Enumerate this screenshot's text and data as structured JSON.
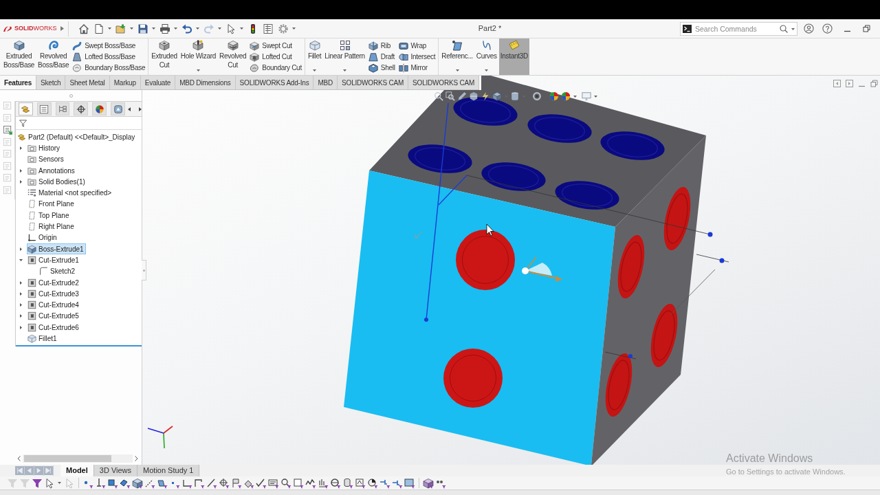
{
  "title_bar": {
    "logo": "**SOLID**WORKS",
    "document_title": "Part2 *",
    "search": {
      "placeholder": "Search Commands"
    }
  },
  "quick_access": [
    {
      "kind": "home",
      "disabled": false
    },
    {
      "kind": "new",
      "dropdown": true,
      "disabled": false
    },
    {
      "kind": "open",
      "dropdown": true,
      "disabled": false
    },
    {
      "kind": "save",
      "dropdown": true,
      "disabled": false
    },
    {
      "kind": "print",
      "dropdown": true,
      "disabled": false
    },
    {
      "kind": "undo",
      "dropdown": true,
      "disabled": false
    },
    {
      "kind": "redo",
      "dropdown": true,
      "disabled": true
    },
    {
      "kind": "select",
      "dropdown": true,
      "disabled": false
    },
    {
      "kind": "rebuild",
      "disabled": false
    },
    {
      "kind": "properties",
      "disabled": false
    },
    {
      "kind": "options",
      "dropdown": true,
      "disabled": false
    }
  ],
  "ribbon": [
    {
      "items": [
        {
          "kind": "large",
          "label": "Extruded\nBoss/Base",
          "pressed": false
        },
        {
          "kind": "large",
          "label": "Revolved\nBoss/Base",
          "pressed": false
        },
        {
          "kind": "stack",
          "labels": [
            "Swept Boss/Base",
            "Lofted Boss/Base",
            "Boundary Boss/Base"
          ]
        }
      ]
    },
    {
      "items": [
        {
          "kind": "large",
          "label": "Extruded\nCut",
          "pressed": false
        },
        {
          "kind": "large",
          "label": "Hole Wizard",
          "dropdown": true,
          "pressed": false
        },
        {
          "kind": "large",
          "label": "Revolved\nCut",
          "pressed": false
        },
        {
          "kind": "stack",
          "labels": [
            "Swept Cut",
            "Lofted Cut",
            "Boundary Cut"
          ]
        }
      ]
    },
    {
      "items": [
        {
          "kind": "large",
          "label": "Fillet",
          "dropdown": true,
          "pressed": false
        },
        {
          "kind": "large",
          "label": "Linear Pattern",
          "dropdown": true,
          "pressed": false
        },
        {
          "kind": "stack",
          "labels": [
            "Rib",
            "Draft",
            "Shell"
          ]
        },
        {
          "kind": "stack",
          "labels": [
            "Wrap",
            "Intersect",
            "Mirror"
          ]
        }
      ]
    },
    {
      "items": [
        {
          "kind": "large",
          "label": "Referenc...",
          "dropdown": true,
          "pressed": false
        },
        {
          "kind": "large",
          "label": "Curves",
          "dropdown": true,
          "pressed": false
        },
        {
          "kind": "large",
          "label": "Instant3D",
          "pressed": true
        }
      ]
    }
  ],
  "tabs": [
    {
      "label": "Features",
      "selected": true
    },
    {
      "label": "Sketch",
      "selected": false
    },
    {
      "label": "Sheet Metal",
      "selected": false
    },
    {
      "label": "Markup",
      "selected": false
    },
    {
      "label": "Evaluate",
      "selected": false
    },
    {
      "label": "MBD Dimensions",
      "selected": false
    },
    {
      "label": "SOLIDWORKS Add-Ins",
      "selected": false
    },
    {
      "label": "MBD",
      "selected": false
    },
    {
      "label": "SOLIDWORKS CAM",
      "selected": false
    },
    {
      "label": "SOLIDWORKS CAM",
      "selected": false
    }
  ],
  "side_tools": [
    {
      "disabled": true
    },
    {
      "disabled": true
    },
    {
      "disabled": false
    },
    {
      "disabled": true
    },
    {
      "disabled": true
    },
    {
      "disabled": true
    },
    {
      "disabled": true
    },
    {
      "disabled": true
    }
  ],
  "panel_tabs": [
    {
      "selected": true
    },
    {
      "selected": false
    },
    {
      "selected": false
    },
    {
      "selected": false
    },
    {
      "selected": false
    },
    {
      "selected": false
    }
  ],
  "tree": {
    "label": "Part2 (Default) <<Default>_Display",
    "selected": false,
    "children": [
      {
        "label": "History",
        "kind": "folder",
        "expanded": false,
        "selected": false
      },
      {
        "label": "Sensors",
        "kind": "folder",
        "selected": false
      },
      {
        "label": "Annotations",
        "kind": "folder",
        "expanded": false,
        "selected": false
      },
      {
        "label": "Solid Bodies(1)",
        "kind": "folder",
        "expanded": false,
        "selected": false
      },
      {
        "label": "Material <not specified>",
        "kind": "material",
        "selected": false
      },
      {
        "label": "Front Plane",
        "kind": "plane",
        "selected": false
      },
      {
        "label": "Top Plane",
        "kind": "plane",
        "selected": false
      },
      {
        "label": "Right Plane",
        "kind": "plane",
        "selected": false
      },
      {
        "label": "Origin",
        "kind": "origin",
        "selected": false
      },
      {
        "label": "Boss-Extrude1",
        "kind": "boss",
        "expanded": false,
        "selected": true
      },
      {
        "label": "Cut-Extrude1",
        "kind": "cut",
        "expanded": true,
        "selected": false,
        "children": [
          {
            "label": "Sketch2",
            "kind": "sketch",
            "selected": false
          }
        ]
      },
      {
        "label": "Cut-Extrude2",
        "kind": "cut",
        "expanded": false,
        "selected": false
      },
      {
        "label": "Cut-Extrude3",
        "kind": "cut",
        "expanded": false,
        "selected": false
      },
      {
        "label": "Cut-Extrude4",
        "kind": "cut",
        "expanded": false,
        "selected": false
      },
      {
        "label": "Cut-Extrude5",
        "kind": "cut",
        "expanded": false,
        "selected": false
      },
      {
        "label": "Cut-Extrude6",
        "kind": "cut",
        "expanded": false,
        "selected": false
      },
      {
        "label": "Fillet1",
        "kind": "fillet",
        "selected": false
      }
    ]
  },
  "bottom_tabs": [
    {
      "label": "Model",
      "selected": true
    },
    {
      "label": "3D Views",
      "selected": false
    },
    {
      "label": "Motion Study 1",
      "selected": false
    }
  ],
  "filter_toolbar": [
    {
      "disabled": true
    },
    {
      "disabled": true
    },
    {
      "disabled": false
    },
    {
      "disabled": false
    },
    {
      "disabled": true
    },
    {
      "disabled": false
    },
    {
      "disabled": false
    },
    {
      "disabled": false
    },
    {
      "disabled": false
    },
    {
      "disabled": false
    },
    {
      "disabled": false
    },
    {
      "disabled": false
    },
    {
      "disabled": false
    },
    {
      "disabled": false
    },
    {
      "disabled": false
    },
    {
      "disabled": false
    },
    {
      "disabled": false
    },
    {
      "disabled": false
    },
    {
      "disabled": false
    },
    {
      "disabled": false
    },
    {
      "disabled": false
    },
    {
      "disabled": false
    },
    {
      "disabled": false
    },
    {
      "disabled": false
    },
    {
      "disabled": false
    },
    {
      "disabled": false
    },
    {
      "disabled": false
    },
    {
      "disabled": false
    },
    {
      "disabled": false
    },
    {
      "disabled": false
    },
    {
      "disabled": false
    },
    {
      "disabled": false
    },
    {
      "disabled": false
    },
    {
      "disabled": false
    }
  ],
  "activation_notice": {
    "title": "Activate Windows",
    "subtitle": "Go to Settings to activate Windows."
  }
}
